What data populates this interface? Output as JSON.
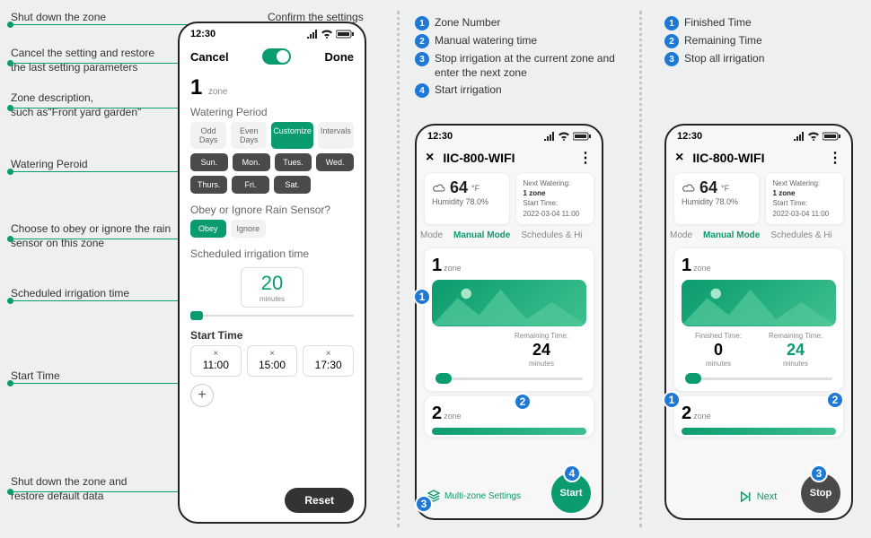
{
  "annotations": {
    "a1": "Shut down the zone",
    "a2": "Confirm the settings",
    "a3": "Cancel the setting and restore the last setting parameters",
    "a4": "Zone description,\nsuch as\"Front yard garden\"",
    "a5": "Watering Peroid",
    "a6": "Choose to obey or ignore the rain sensor on this zone",
    "a7": "Scheduled irrigation time",
    "a8": "Start Time",
    "a9": "Shut down the zone and restore default data"
  },
  "legend_left": [
    "Zone Number",
    "Manual watering time",
    "Stop irrigation at the current zone and enter the next zone",
    "Start irrigation"
  ],
  "legend_right": [
    "Finished Time",
    "Remaining Time",
    "Stop all irrigation"
  ],
  "phone1": {
    "time": "12:30",
    "cancel": "Cancel",
    "done": "Done",
    "zone_num": "1",
    "zone_lbl": "zone",
    "watering_period": "Watering Period",
    "period_opts": [
      "Odd Days",
      "Even Days",
      "Customize",
      "Intervals"
    ],
    "days": [
      "Sun.",
      "Mon.",
      "Tues.",
      "Wed.",
      "Thurs.",
      "Fri.",
      "Sat."
    ],
    "rain_q": "Obey or Ignore Rain Sensor?",
    "obey": "Obey",
    "ignore": "Ignore",
    "sched_title": "Scheduled irrigation time",
    "minutes_val": "20",
    "minutes_lbl": "minutes",
    "start_time": "Start Time",
    "times": [
      "11:00",
      "15:00",
      "17:30"
    ],
    "reset": "Reset"
  },
  "device": {
    "time": "12:30",
    "name": "IIC-800-WIFI",
    "temp": "64",
    "temp_unit": "°F",
    "humidity_lbl": "Humidity",
    "humidity": "78.0%",
    "next_watering_lbl": "Next Watering:",
    "next_zone": "1 zone",
    "start_time_lbl": "Start Time:",
    "next_time": "2022-03-04 11:00",
    "tabs": [
      "Mode",
      "Manual Mode",
      "Schedules & Hi"
    ],
    "zone1": "1",
    "zone2": "2",
    "zone_lbl": "zone",
    "remaining_lbl": "Remaining Time:",
    "remaining_val": "24",
    "finished_lbl": "Finished Time:",
    "finished_val": "0",
    "minutes": "minutes",
    "multizone": "Multi-zone Settings",
    "start": "Start",
    "stop": "Stop",
    "next": "Next"
  }
}
